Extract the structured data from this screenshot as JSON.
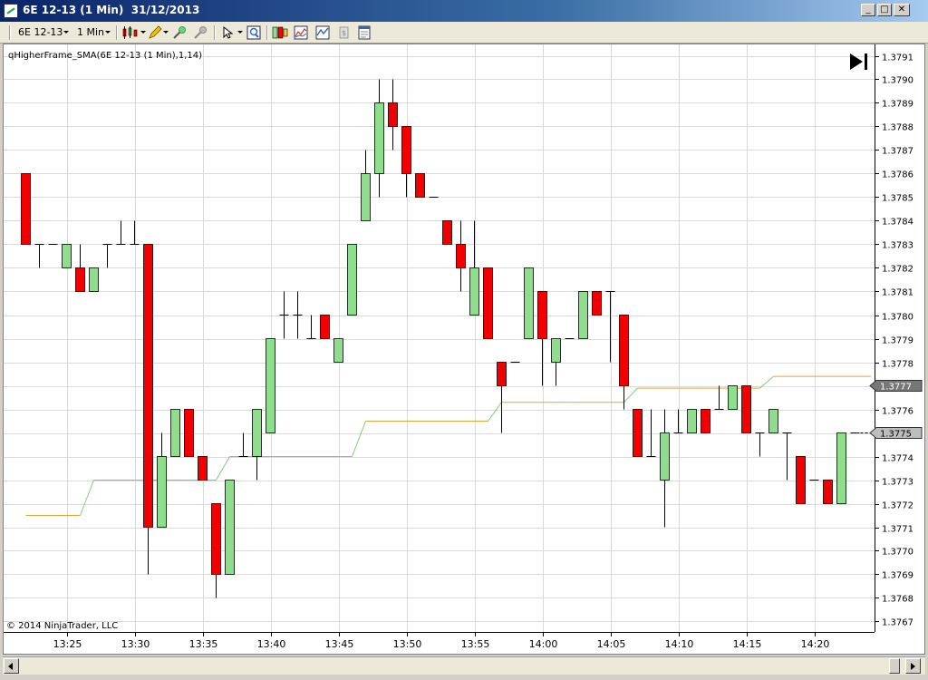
{
  "window": {
    "title": "6E 12-13 (1 Min)  31/12/2013",
    "min_label": "_",
    "max_label": "□",
    "close_label": "✕"
  },
  "toolbar": {
    "instrument": "6E 12-13",
    "interval": "1 Min"
  },
  "chart": {
    "indicator_label": "qHigherFrame_SMA(6E 12-13 (1 Min),1,14)",
    "copyright": "© 2014 NinjaTrader, LLC",
    "sma_price_marker": "1.3777",
    "last_price_marker": "1.3775",
    "colors": {
      "up": "#8ede8e",
      "down": "#f00000",
      "sma_down": "#e6a33a",
      "sma_up": "#7fcf6f"
    }
  },
  "chart_data": {
    "type": "candlestick",
    "yaxis_ticks": [
      "1.3767",
      "1.3768",
      "1.3769",
      "1.3770",
      "1.3771",
      "1.3772",
      "1.3773",
      "1.3774",
      "1.3775",
      "1.3776",
      "1.3777",
      "1.3778",
      "1.3779",
      "1.3780",
      "1.3781",
      "1.3782",
      "1.3783",
      "1.3784",
      "1.3785",
      "1.3786",
      "1.3787",
      "1.3788",
      "1.3789",
      "1.3790",
      "1.3791"
    ],
    "xaxis_ticks": [
      "13:25",
      "13:30",
      "13:35",
      "13:40",
      "13:45",
      "13:50",
      "13:55",
      "14:00",
      "14:05",
      "14:10",
      "14:15",
      "14:20"
    ],
    "candles": [
      {
        "t": "13:25",
        "o": 1.3786,
        "h": 1.3786,
        "l": 1.3783,
        "c": 1.3783
      },
      {
        "t": "13:26",
        "o": 1.3783,
        "h": 1.3783,
        "l": 1.3782,
        "c": 1.3783
      },
      {
        "t": "13:27",
        "o": 1.3783,
        "h": 1.3783,
        "l": 1.3783,
        "c": 1.3783
      },
      {
        "t": "13:28",
        "o": 1.3782,
        "h": 1.3783,
        "l": 1.3782,
        "c": 1.3783
      },
      {
        "t": "13:29",
        "o": 1.3782,
        "h": 1.3783,
        "l": 1.3781,
        "c": 1.3781
      },
      {
        "t": "13:30",
        "o": 1.3781,
        "h": 1.3782,
        "l": 1.3781,
        "c": 1.3782
      },
      {
        "t": "13:31",
        "o": 1.3783,
        "h": 1.3783,
        "l": 1.3782,
        "c": 1.3783
      },
      {
        "t": "13:32",
        "o": 1.3783,
        "h": 1.3784,
        "l": 1.3783,
        "c": 1.3783
      },
      {
        "t": "13:33",
        "o": 1.3783,
        "h": 1.3784,
        "l": 1.3783,
        "c": 1.3783
      },
      {
        "t": "13:34",
        "o": 1.3783,
        "h": 1.3783,
        "l": 1.3769,
        "c": 1.3771
      },
      {
        "t": "13:35",
        "o": 1.3771,
        "h": 1.3775,
        "l": 1.3771,
        "c": 1.3774
      },
      {
        "t": "13:36",
        "o": 1.3774,
        "h": 1.3776,
        "l": 1.3774,
        "c": 1.3776
      },
      {
        "t": "13:37",
        "o": 1.3776,
        "h": 1.3776,
        "l": 1.3774,
        "c": 1.3774
      },
      {
        "t": "13:38",
        "o": 1.3774,
        "h": 1.3774,
        "l": 1.3773,
        "c": 1.3773
      },
      {
        "t": "13:39",
        "o": 1.3772,
        "h": 1.3772,
        "l": 1.3768,
        "c": 1.3769
      },
      {
        "t": "13:40",
        "o": 1.3769,
        "h": 1.3773,
        "l": 1.3769,
        "c": 1.3773
      },
      {
        "t": "13:41",
        "o": 1.3774,
        "h": 1.3775,
        "l": 1.3774,
        "c": 1.3774
      },
      {
        "t": "13:42",
        "o": 1.3774,
        "h": 1.3776,
        "l": 1.3773,
        "c": 1.3776
      },
      {
        "t": "13:43",
        "o": 1.3775,
        "h": 1.3779,
        "l": 1.3775,
        "c": 1.3779
      },
      {
        "t": "13:44",
        "o": 1.378,
        "h": 1.3781,
        "l": 1.3779,
        "c": 1.378
      },
      {
        "t": "13:45",
        "o": 1.378,
        "h": 1.3781,
        "l": 1.3779,
        "c": 1.378
      },
      {
        "t": "13:46",
        "o": 1.3779,
        "h": 1.378,
        "l": 1.3779,
        "c": 1.3779
      },
      {
        "t": "13:47",
        "o": 1.378,
        "h": 1.378,
        "l": 1.3779,
        "c": 1.3779
      },
      {
        "t": "13:48",
        "o": 1.3778,
        "h": 1.3779,
        "l": 1.3778,
        "c": 1.3779
      },
      {
        "t": "13:49",
        "o": 1.378,
        "h": 1.3783,
        "l": 1.378,
        "c": 1.3783
      },
      {
        "t": "13:50",
        "o": 1.3784,
        "h": 1.3787,
        "l": 1.3784,
        "c": 1.3786
      },
      {
        "t": "13:51",
        "o": 1.3786,
        "h": 1.379,
        "l": 1.3785,
        "c": 1.3789
      },
      {
        "t": "13:52",
        "o": 1.3789,
        "h": 1.379,
        "l": 1.3787,
        "c": 1.3788
      },
      {
        "t": "13:53",
        "o": 1.3788,
        "h": 1.3788,
        "l": 1.3785,
        "c": 1.3786
      },
      {
        "t": "13:54",
        "o": 1.3786,
        "h": 1.3786,
        "l": 1.3785,
        "c": 1.3785
      },
      {
        "t": "13:55",
        "o": 1.3785,
        "h": 1.3785,
        "l": 1.3785,
        "c": 1.3785
      },
      {
        "t": "13:56",
        "o": 1.3784,
        "h": 1.3784,
        "l": 1.3783,
        "c": 1.3783
      },
      {
        "t": "13:57",
        "o": 1.3783,
        "h": 1.3784,
        "l": 1.3781,
        "c": 1.3782
      },
      {
        "t": "13:58",
        "o": 1.378,
        "h": 1.3784,
        "l": 1.378,
        "c": 1.3782
      },
      {
        "t": "13:59",
        "o": 1.3782,
        "h": 1.3782,
        "l": 1.3779,
        "c": 1.3779
      },
      {
        "t": "14:00",
        "o": 1.3778,
        "h": 1.3778,
        "l": 1.3775,
        "c": 1.3777
      },
      {
        "t": "14:01",
        "o": 1.3778,
        "h": 1.3778,
        "l": 1.3778,
        "c": 1.3778
      },
      {
        "t": "14:02",
        "o": 1.3779,
        "h": 1.3782,
        "l": 1.3779,
        "c": 1.3782
      },
      {
        "t": "14:03",
        "o": 1.3781,
        "h": 1.3781,
        "l": 1.3777,
        "c": 1.3779
      },
      {
        "t": "14:04",
        "o": 1.3778,
        "h": 1.3779,
        "l": 1.3777,
        "c": 1.3779
      },
      {
        "t": "14:05",
        "o": 1.3779,
        "h": 1.3779,
        "l": 1.3779,
        "c": 1.3779
      },
      {
        "t": "14:06",
        "o": 1.3779,
        "h": 1.3781,
        "l": 1.3779,
        "c": 1.3781
      },
      {
        "t": "14:07",
        "o": 1.3781,
        "h": 1.3781,
        "l": 1.378,
        "c": 1.378
      },
      {
        "t": "14:08",
        "o": 1.3781,
        "h": 1.3781,
        "l": 1.3778,
        "c": 1.3781
      },
      {
        "t": "14:09",
        "o": 1.378,
        "h": 1.378,
        "l": 1.3776,
        "c": 1.3777
      },
      {
        "t": "14:10",
        "o": 1.3776,
        "h": 1.3776,
        "l": 1.3774,
        "c": 1.3774
      },
      {
        "t": "14:11",
        "o": 1.3774,
        "h": 1.3776,
        "l": 1.3774,
        "c": 1.3774
      },
      {
        "t": "14:12",
        "o": 1.3773,
        "h": 1.3776,
        "l": 1.3771,
        "c": 1.3775
      },
      {
        "t": "14:13",
        "o": 1.3775,
        "h": 1.3776,
        "l": 1.3775,
        "c": 1.3775
      },
      {
        "t": "14:14",
        "o": 1.3775,
        "h": 1.3776,
        "l": 1.3775,
        "c": 1.3776
      },
      {
        "t": "14:15",
        "o": 1.3776,
        "h": 1.3776,
        "l": 1.3775,
        "c": 1.3775
      },
      {
        "t": "14:16",
        "o": 1.3776,
        "h": 1.3777,
        "l": 1.3776,
        "c": 1.3776
      },
      {
        "t": "14:17",
        "o": 1.3776,
        "h": 1.3777,
        "l": 1.3776,
        "c": 1.3777
      },
      {
        "t": "14:18",
        "o": 1.3777,
        "h": 1.3777,
        "l": 1.3775,
        "c": 1.3775
      },
      {
        "t": "14:19",
        "o": 1.3775,
        "h": 1.3775,
        "l": 1.3774,
        "c": 1.3775
      },
      {
        "t": "14:20",
        "o": 1.3775,
        "h": 1.3776,
        "l": 1.3775,
        "c": 1.3776
      },
      {
        "t": "14:21",
        "o": 1.3775,
        "h": 1.3775,
        "l": 1.3773,
        "c": 1.3775
      },
      {
        "t": "14:22",
        "o": 1.3774,
        "h": 1.3774,
        "l": 1.3772,
        "c": 1.3772
      },
      {
        "t": "14:23",
        "o": 1.3773,
        "h": 1.3773,
        "l": 1.3773,
        "c": 1.3773
      },
      {
        "t": "14:24",
        "o": 1.3773,
        "h": 1.3773,
        "l": 1.3772,
        "c": 1.3772
      },
      {
        "t": "14:25",
        "o": 1.3772,
        "h": 1.3775,
        "l": 1.3772,
        "c": 1.3775
      },
      {
        "t": "14:26",
        "o": 1.3775,
        "h": 1.3775,
        "l": 1.3775,
        "c": 1.3775
      }
    ],
    "sma_steps": [
      {
        "from": "13:25",
        "to": "13:29",
        "v": 1.37715
      },
      {
        "from": "13:30",
        "to": "13:34",
        "v": 1.3773
      },
      {
        "from": "13:35",
        "to": "13:39",
        "v": 1.3773
      },
      {
        "from": "13:40",
        "to": "13:44",
        "v": 1.3774
      },
      {
        "from": "13:45",
        "to": "13:49",
        "v": 1.3774
      },
      {
        "from": "13:50",
        "to": "13:54",
        "v": 1.37755
      },
      {
        "from": "13:55",
        "to": "13:59",
        "v": 1.37755
      },
      {
        "from": "14:00",
        "to": "14:04",
        "v": 1.37763
      },
      {
        "from": "14:05",
        "to": "14:09",
        "v": 1.37763
      },
      {
        "from": "14:10",
        "to": "14:14",
        "v": 1.37769
      },
      {
        "from": "14:15",
        "to": "14:19",
        "v": 1.37769
      },
      {
        "from": "14:20",
        "to": "14:25",
        "v": 1.37774
      }
    ]
  }
}
